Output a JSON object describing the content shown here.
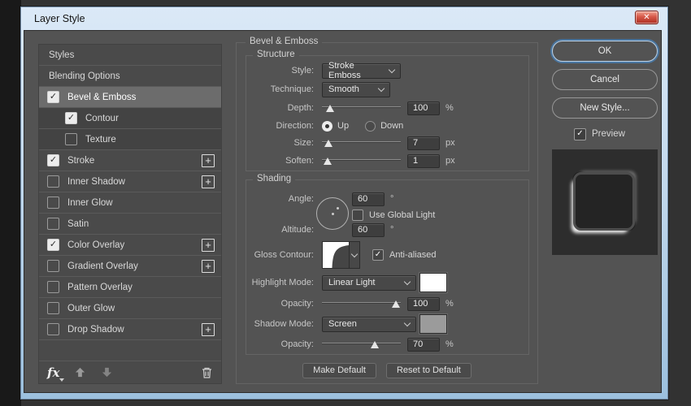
{
  "window": {
    "title": "Layer Style"
  },
  "icons": {
    "check": "✓",
    "plus": "+",
    "close": "✕"
  },
  "colors": {
    "titlebar_blue": "#bcd6ee",
    "dialog_bg": "#535353",
    "sidebar_bg": "#4a4a4a",
    "selected_row": "#6c6c6c",
    "ok_ring_blue": "#49759f",
    "close_button_red": "#c0392b",
    "highlight_swatch": "#ffffff",
    "shadow_swatch": "#9b9b9b"
  },
  "sidebar": {
    "items": [
      {
        "label": "Styles",
        "checkbox": false
      },
      {
        "label": "Blending Options",
        "checkbox": false
      },
      {
        "label": "Bevel & Emboss",
        "checkbox": true,
        "checked": true,
        "selected": true
      },
      {
        "label": "Contour",
        "checkbox": true,
        "checked": true,
        "indented": true
      },
      {
        "label": "Texture",
        "checkbox": true,
        "checked": false,
        "indented": true
      },
      {
        "label": "Stroke",
        "checkbox": true,
        "checked": true,
        "plus": true
      },
      {
        "label": "Inner Shadow",
        "checkbox": true,
        "checked": false,
        "plus": true
      },
      {
        "label": "Inner Glow",
        "checkbox": true,
        "checked": false
      },
      {
        "label": "Satin",
        "checkbox": true,
        "checked": false
      },
      {
        "label": "Color Overlay",
        "checkbox": true,
        "checked": true,
        "plus": true
      },
      {
        "label": "Gradient Overlay",
        "checkbox": true,
        "checked": false,
        "plus": true
      },
      {
        "label": "Pattern Overlay",
        "checkbox": true,
        "checked": false
      },
      {
        "label": "Outer Glow",
        "checkbox": true,
        "checked": false
      },
      {
        "label": "Drop Shadow",
        "checkbox": true,
        "checked": false,
        "plus": true
      }
    ],
    "toolbar": {
      "fx_label": "fx"
    }
  },
  "main": {
    "title": "Bevel & Emboss",
    "structure": {
      "title": "Structure",
      "style_label": "Style:",
      "style_value": "Stroke Emboss",
      "technique_label": "Technique:",
      "technique_value": "Smooth",
      "depth_label": "Depth:",
      "depth_value": "100",
      "depth_unit": "%",
      "direction_label": "Direction:",
      "up_label": "Up",
      "down_label": "Down",
      "size_label": "Size:",
      "size_value": "7",
      "size_unit": "px",
      "soften_label": "Soften:",
      "soften_value": "1",
      "soften_unit": "px"
    },
    "shading": {
      "title": "Shading",
      "angle_label": "Angle:",
      "angle_value": "60",
      "angle_unit": "°",
      "global_light_label": "Use Global Light",
      "altitude_label": "Altitude:",
      "altitude_value": "60",
      "altitude_unit": "°",
      "gloss_label": "Gloss Contour:",
      "antialiased_label": "Anti-aliased",
      "highlight_mode_label": "Highlight Mode:",
      "highlight_mode_value": "Linear Light",
      "opacity1_label": "Opacity:",
      "opacity1_value": "100",
      "opacity1_unit": "%",
      "shadow_mode_label": "Shadow Mode:",
      "shadow_mode_value": "Screen",
      "opacity2_label": "Opacity:",
      "opacity2_value": "70",
      "opacity2_unit": "%"
    },
    "footer": {
      "make_default": "Make Default",
      "reset_default": "Reset to Default"
    }
  },
  "actions": {
    "ok": "OK",
    "cancel": "Cancel",
    "new_style": "New Style...",
    "preview": "Preview"
  }
}
